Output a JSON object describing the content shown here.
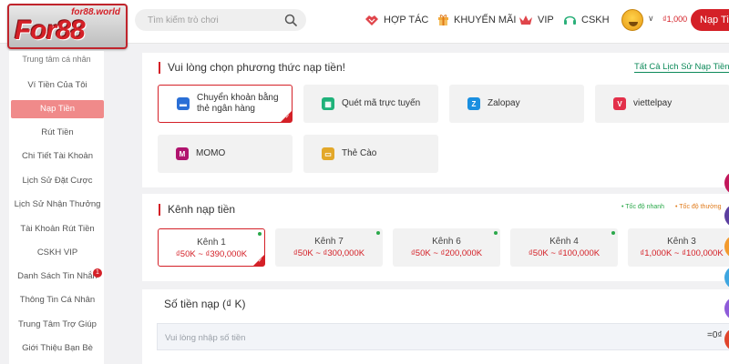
{
  "header": {
    "logo": {
      "main": "For88",
      "sub": "for88.world"
    },
    "search": {
      "placeholder": "Tìm kiếm trò chơi"
    },
    "nav": [
      {
        "label": "HỢP TÁC",
        "icon": "handshake-icon"
      },
      {
        "label": "KHUYẾN MÃI",
        "icon": "gift-icon"
      },
      {
        "label": "VIP",
        "icon": "crown-icon"
      },
      {
        "label": "CSKH",
        "icon": "headset-icon"
      }
    ],
    "balance": "₫1,000",
    "deposit_button": "Nạp Tiền"
  },
  "sidebar": {
    "title": "Trung tâm cá nhân",
    "items": [
      {
        "label": "Ví Tiền Của Tôi"
      },
      {
        "label": "Nạp Tiền",
        "active": true
      },
      {
        "label": "Rút Tiền"
      },
      {
        "label": "Chi Tiết Tài Khoản"
      },
      {
        "label": "Lịch Sử Đặt Cược"
      },
      {
        "label": "Lịch Sử Nhận Thưởng"
      },
      {
        "label": "Tài Khoản Rút Tiền"
      },
      {
        "label": "CSKH VIP"
      },
      {
        "label": "Danh Sách Tin Nhắn",
        "badge": "1"
      },
      {
        "label": "Thông Tin Cá Nhân"
      },
      {
        "label": "Trung Tâm Trợ Giúp"
      },
      {
        "label": "Giới Thiệu Bạn Bè"
      }
    ]
  },
  "method_section": {
    "title": "Vui lòng chọn phương thức nạp tiền!",
    "history_link": "Tất Cả Lịch Sử Nạp Tiền",
    "methods": [
      {
        "label": "Chuyển khoản bằng thẻ ngân hàng",
        "icon": "bank-card-icon",
        "selected": true
      },
      {
        "label": "Quét mã trực tuyến",
        "icon": "qr-code-icon"
      },
      {
        "label": "Zalopay",
        "icon": "zalopay-icon"
      },
      {
        "label": "viettelpay",
        "icon": "viettelpay-icon"
      },
      {
        "label": "MOMO",
        "icon": "momo-icon"
      },
      {
        "label": "Thẻ Cào",
        "icon": "scratch-card-icon"
      }
    ]
  },
  "channel_section": {
    "title": "Kênh nạp tiền",
    "legend_fast": "• Tốc độ nhanh",
    "legend_normal": "• Tốc độ thường",
    "channels": [
      {
        "name": "Kênh 1",
        "range": "₫50K ~ ₫390,000K",
        "selected": true
      },
      {
        "name": "Kênh 7",
        "range": "₫50K ~ ₫300,000K"
      },
      {
        "name": "Kênh 6",
        "range": "₫50K ~ ₫200,000K"
      },
      {
        "name": "Kênh 4",
        "range": "₫50K ~ ₫100,000K"
      },
      {
        "name": "Kênh 3",
        "range": "₫1,000K ~ ₫100,000K"
      }
    ]
  },
  "amount_section": {
    "title": "Số tiền nạp (₫ K)",
    "placeholder": "Vui lòng nhập số tiền",
    "total": "=0₫"
  },
  "colors": {
    "accent": "#d42027",
    "link": "#0d8a5a",
    "fast": "#2aa84a",
    "normal": "#e07a1a"
  }
}
